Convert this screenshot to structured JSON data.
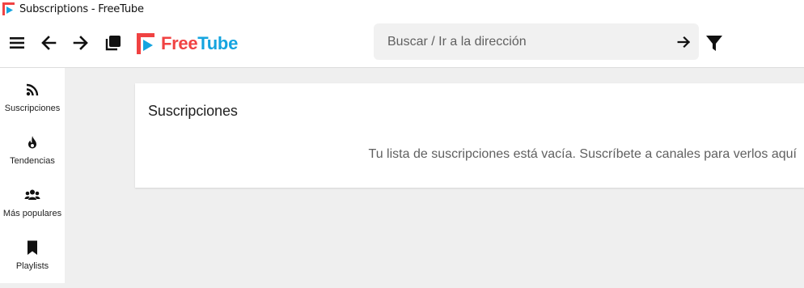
{
  "window": {
    "title": "Subscriptions - FreeTube",
    "app_icon": "freetube-logo-icon"
  },
  "topnav": {
    "menu_icon": "hamburger-menu-icon",
    "back_icon": "arrow-left-icon",
    "forward_icon": "arrow-right-icon",
    "new_window_icon": "new-window-icon",
    "logo": {
      "part1": "Free",
      "part2": "Tube",
      "colors": {
        "free": "#f04242",
        "tube": "#14a4df"
      }
    },
    "search": {
      "placeholder": "Buscar / Ir a la dirección",
      "value": "",
      "go_icon": "arrow-right-icon"
    },
    "filter_icon": "filter-icon"
  },
  "sidebar": {
    "items": [
      {
        "label": "Suscripciones",
        "icon": "rss-icon"
      },
      {
        "label": "Tendencias",
        "icon": "fire-icon"
      },
      {
        "label": "Más populares",
        "icon": "users-icon"
      },
      {
        "label": "Playlists",
        "icon": "bookmark-icon"
      }
    ]
  },
  "main": {
    "heading": "Suscripciones",
    "empty_message": "Tu lista de suscripciones está vacía. Suscríbete a canales para verlos aquí"
  },
  "colors": {
    "background": "#efefef",
    "card": "#ffffff",
    "muted_text": "#606060"
  }
}
